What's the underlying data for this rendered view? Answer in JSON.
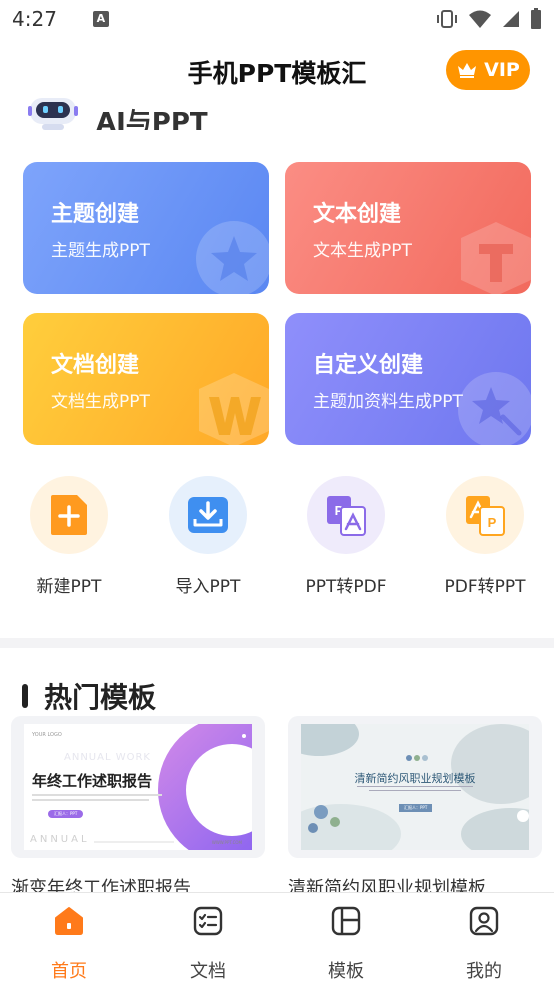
{
  "status": {
    "time": "4:27",
    "notif_letter": "A"
  },
  "header": {
    "title": "手机PPT模板汇",
    "vip_label": "VIP"
  },
  "ai_section": {
    "label": "AI与PPT"
  },
  "cards": [
    {
      "title": "主题创建",
      "subtitle": "主题生成PPT"
    },
    {
      "title": "文本创建",
      "subtitle": "文本生成PPT"
    },
    {
      "title": "文档创建",
      "subtitle": "文档生成PPT"
    },
    {
      "title": "自定义创建",
      "subtitle": "主题加资料生成PPT"
    }
  ],
  "tools": [
    {
      "label": "新建PPT",
      "icon": "add-file-icon"
    },
    {
      "label": "导入PPT",
      "icon": "import-tray-icon"
    },
    {
      "label": "PPT转PDF",
      "icon": "ppt-to-pdf-icon"
    },
    {
      "label": "PDF转PPT",
      "icon": "pdf-to-ppt-icon"
    }
  ],
  "hot": {
    "title": "热门模板",
    "templates": [
      {
        "name": "渐变年终工作述职报告",
        "thumb": {
          "logo": "YOUR LOGO",
          "ghost": "ANNUAL WORK",
          "heading": "年终工作述职报告",
          "button": "汇报人：PPT",
          "footer": "ANNUAL",
          "url": "WWW.PPT.COM"
        }
      },
      {
        "name": "清新简约风职业规划模板",
        "thumb": {
          "heading": "清新简约风职业规划模板",
          "button": "汇报人：PPT"
        }
      }
    ]
  },
  "nav": [
    {
      "label": "首页",
      "active": true
    },
    {
      "label": "文档",
      "active": false
    },
    {
      "label": "模板",
      "active": false
    },
    {
      "label": "我的",
      "active": false
    }
  ],
  "colors": {
    "accent": "#ff9500",
    "active_nav": "#ff7a1a",
    "card_blue": "#6a93f6",
    "card_red": "#f57a6e",
    "card_yellow": "#ffbb30",
    "card_purple": "#7d82f4"
  }
}
